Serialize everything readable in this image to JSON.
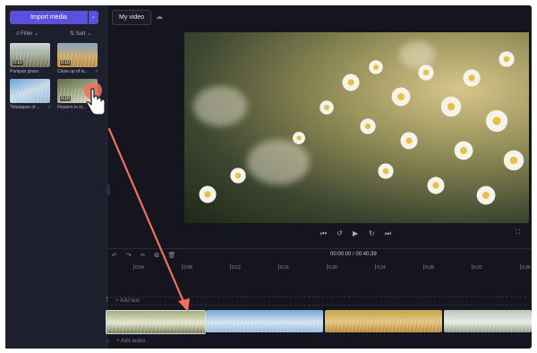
{
  "media_panel": {
    "import_label": "Import media",
    "import_caret": "⌄",
    "filter_label": "Filter",
    "sort_label": "Sort",
    "thumbnails": [
      {
        "title": "Pampas grass",
        "duration": "0:10",
        "checked": false
      },
      {
        "title": "Close up of w...",
        "duration": "0:10",
        "checked": true
      },
      {
        "title": "Timelapse of ...",
        "duration": "",
        "checked": true
      },
      {
        "title": "Flowers in m...",
        "duration": "0:10",
        "checked": true
      }
    ],
    "check_mark": "✓"
  },
  "header": {
    "project_title": "My video"
  },
  "player": {
    "controls": [
      "⏮",
      "↺",
      "▶",
      "↻",
      "⏭"
    ],
    "fullscreen_glyph": "⛶"
  },
  "timeline": {
    "tools": [
      "↶",
      "↷",
      "✂",
      "⧉",
      "🗑"
    ],
    "current_time": "00:00.00",
    "separator": "/",
    "total_time": "00:40.39",
    "ticks": [
      "0:04",
      "0:08",
      "0:12",
      "0:16",
      "0:20",
      "0:24",
      "0:28",
      "0:32",
      "0:36"
    ],
    "add_text_label": "+ Add text",
    "add_audio_label": "+ Add audio",
    "text_icon": "T",
    "audio_icon": "♫"
  },
  "colors": {
    "accent": "#5b4fe0",
    "drag_arrow": "#f07060",
    "panel_bg": "#1e1f2d",
    "app_bg": "#15151f"
  }
}
